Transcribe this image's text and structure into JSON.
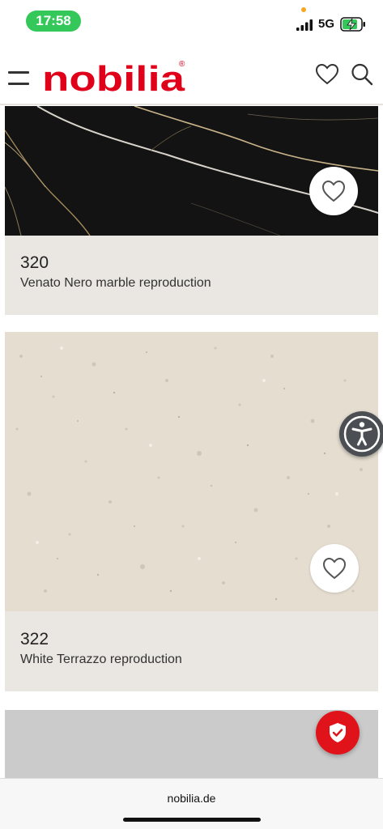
{
  "status_bar": {
    "time": "17:58",
    "network": "5G",
    "signal_icon": "cellular-signal-icon",
    "battery_icon": "battery-charging-icon"
  },
  "header": {
    "menu_icon": "hamburger-menu-icon",
    "logo_text": "nobilia",
    "logo_mark": "®",
    "wishlist_icon": "heart-outline-icon",
    "search_icon": "search-icon",
    "brand_color": "#e1001a"
  },
  "cards": [
    {
      "code": "320",
      "name": "Venato Nero marble reproduction",
      "favorite_icon": "heart-outline-icon",
      "swatch_color": "#141414"
    },
    {
      "code": "322",
      "name": "White Terrazzo reproduction",
      "favorite_icon": "heart-outline-icon",
      "swatch_color": "#e6ded0"
    },
    {
      "swatch_color": "#cbcbcb"
    }
  ],
  "floating": {
    "accessibility_icon": "accessibility-icon",
    "privacy_icon": "shield-check-icon"
  },
  "browser": {
    "url": "nobilia.de"
  }
}
